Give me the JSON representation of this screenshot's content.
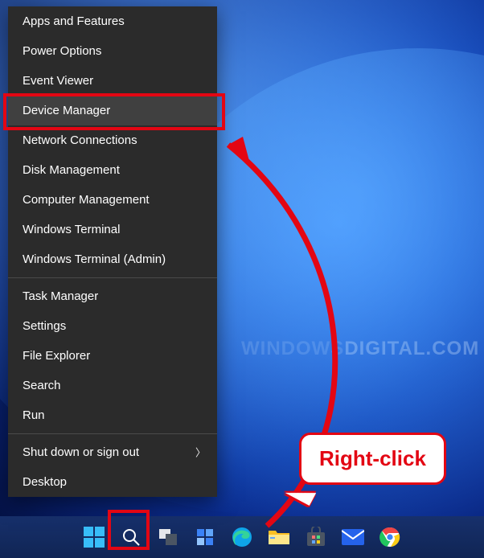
{
  "menu": {
    "items": [
      {
        "label": "Apps and Features",
        "hover": false,
        "submenu": false
      },
      {
        "label": "Power Options",
        "hover": false,
        "submenu": false
      },
      {
        "label": "Event Viewer",
        "hover": false,
        "submenu": false
      },
      {
        "label": "Device Manager",
        "hover": true,
        "submenu": false
      },
      {
        "label": "Network Connections",
        "hover": false,
        "submenu": false
      },
      {
        "label": "Disk Management",
        "hover": false,
        "submenu": false
      },
      {
        "label": "Computer Management",
        "hover": false,
        "submenu": false
      },
      {
        "label": "Windows Terminal",
        "hover": false,
        "submenu": false
      },
      {
        "label": "Windows Terminal (Admin)",
        "hover": false,
        "submenu": false
      }
    ],
    "items2": [
      {
        "label": "Task Manager",
        "hover": false,
        "submenu": false
      },
      {
        "label": "Settings",
        "hover": false,
        "submenu": false
      },
      {
        "label": "File Explorer",
        "hover": false,
        "submenu": false
      },
      {
        "label": "Search",
        "hover": false,
        "submenu": false
      },
      {
        "label": "Run",
        "hover": false,
        "submenu": false
      }
    ],
    "items3": [
      {
        "label": "Shut down or sign out",
        "hover": false,
        "submenu": true
      },
      {
        "label": "Desktop",
        "hover": false,
        "submenu": false
      }
    ]
  },
  "taskbar": {
    "icons": [
      "start",
      "search",
      "task-view",
      "widgets",
      "edge",
      "file-explorer",
      "store",
      "mail",
      "chrome"
    ]
  },
  "annotations": {
    "callout": "Right-click",
    "highlighted_menu_item": "Device Manager",
    "highlighted_taskbar_icon": "start"
  },
  "watermark": {
    "prefix": "W",
    "rest": "INDOWS",
    "suffix": "DIGITAL.COM"
  },
  "colors": {
    "highlight": "#e30613",
    "menu_bg": "#2b2b2b",
    "menu_hover": "#404040",
    "taskbar": "#17306c"
  }
}
